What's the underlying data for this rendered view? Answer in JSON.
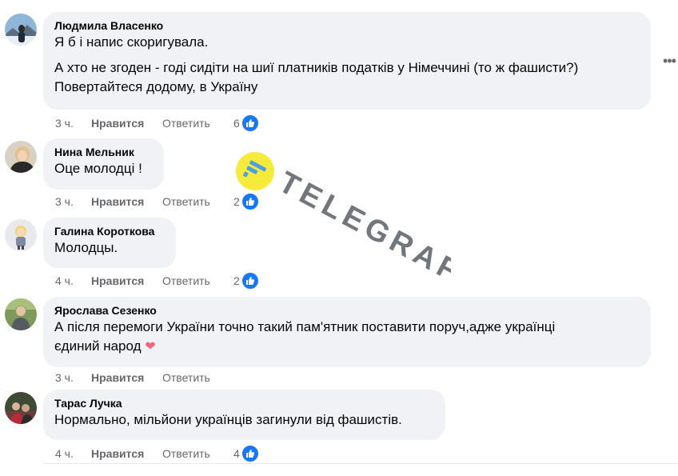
{
  "comments": [
    {
      "author": "Людмила Власенко",
      "lines": [
        "Я б і напис скоригувала."
      ],
      "lines2": [
        "А хто не згоден - годі сидіти на шиї платників податків у Німеччині (то ж фашисти?)",
        "Повертайтеся додому, в Україну"
      ],
      "time": "3 ч.",
      "like_label": "Нравится",
      "reply_label": "Ответить",
      "reactions": "6"
    },
    {
      "author": "Нина Мельник",
      "lines": [
        "Оце молодці !"
      ],
      "time": "3 ч.",
      "like_label": "Нравится",
      "reply_label": "Ответить",
      "reactions": "2"
    },
    {
      "author": "Галина Короткова",
      "lines": [
        "Молодцы."
      ],
      "time": "4 ч.",
      "like_label": "Нравится",
      "reply_label": "Ответить",
      "reactions": "2"
    },
    {
      "author": "Ярослава Сезенко",
      "lines": [
        "А після перемоги України точно такий пам'ятник поставити поруч,адже українці",
        "єдиний народ"
      ],
      "time": "3 ч.",
      "like_label": "Нравится",
      "reply_label": "Ответить",
      "reactions": ""
    },
    {
      "author": "Тарас Лучка",
      "lines": [
        "Нормально, мільйони українців загинули від фашистів."
      ],
      "time": "4 ч.",
      "like_label": "Нравится",
      "reply_label": "Ответить",
      "reactions": "4"
    }
  ],
  "more_options_icon": "more-horizontal-icon",
  "watermark": {
    "text": "TELEGRAF",
    "logo_color": "#f5e82a",
    "mark_color": "#4a9fe0"
  },
  "colors": {
    "bubble": "#f0f2f5",
    "like_blue": "#1877f2",
    "meta_gray": "#65676b"
  }
}
